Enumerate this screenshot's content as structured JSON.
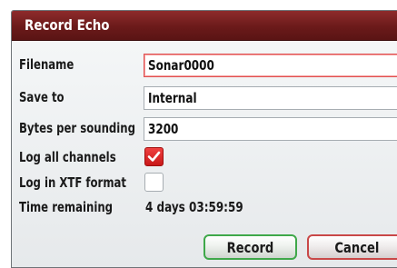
{
  "dialog": {
    "title": "Record Echo",
    "filename_label": "Filename",
    "filename_value": "Sonar0000",
    "save_to_label": "Save to",
    "save_to_value": "Internal",
    "bytes_label": "Bytes per sounding",
    "bytes_value": "3200",
    "log_all_label": "Log all channels",
    "log_all_checked": true,
    "log_xtf_label": "Log in XTF format",
    "log_xtf_checked": false,
    "time_label": "Time remaining",
    "time_value": "4 days 03:59:59",
    "record_label": "Record",
    "cancel_label": "Cancel"
  },
  "colors": {
    "title_bar": "#6b1a1a",
    "checkbox_on": "#d82020",
    "record_border": "#3fa84a",
    "cancel_border": "#c94848"
  }
}
